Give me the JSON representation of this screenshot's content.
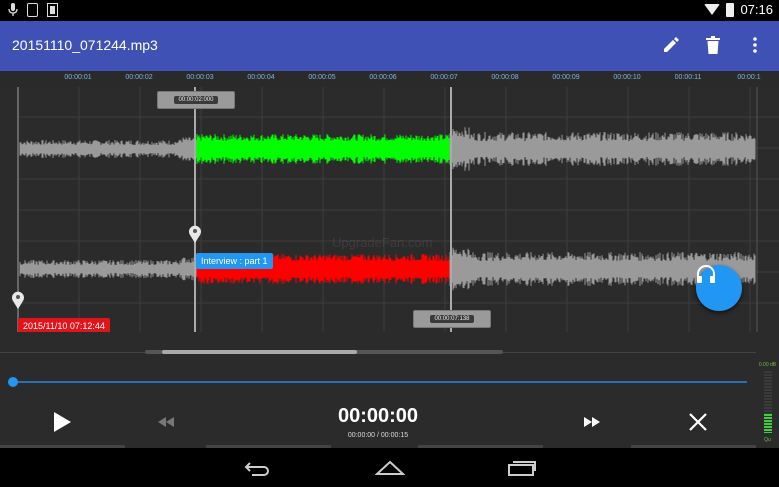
{
  "status_bar": {
    "time": "07:16",
    "left_icons": [
      "microphone-icon",
      "sim-icon",
      "storage-icon"
    ],
    "right_icons": [
      "wifi-icon",
      "battery-icon"
    ]
  },
  "app_bar": {
    "title": "20151110_071244.mp3",
    "color": "#3f51b5",
    "actions": [
      "edit-icon",
      "delete-icon",
      "more-vert-icon"
    ]
  },
  "timeline": {
    "ticks": [
      "00:00:01",
      "00:00:02",
      "00:00:03",
      "00:00:04",
      "00:00:05",
      "00:00:06",
      "00:00:07",
      "00:00:08",
      "00:00:09",
      "00:00:10",
      "00:00:11",
      "00:00:1"
    ]
  },
  "waveform": {
    "selection_start_marker": "00:00:02:000",
    "selection_end_marker": "00:00:07:138",
    "selection_color_top": "#00ff00",
    "selection_color_bottom": "#ff0000",
    "wave_color": "#9a9a9a",
    "watermark": "UpgradeFan.com",
    "markers": [
      {
        "label": "Interview : part 1",
        "color": "#2196f3"
      },
      {
        "label": "2015/11/10 07:12:44",
        "color": "#e0141a"
      }
    ]
  },
  "fab": {
    "icon": "headphones-icon",
    "color": "#2196f3"
  },
  "playback": {
    "position_fraction": 0,
    "current_time": "00:00:00",
    "sub_time": "00:00:00 / 00:00:15"
  },
  "transport": {
    "buttons": [
      "play-icon",
      "rewind-icon",
      "fast-forward-icon",
      "close-icon"
    ]
  },
  "level_meter": {
    "top_label": "0.00 dB",
    "bottom_label": "Qu",
    "level_fraction": 0.3
  },
  "nav_bar": {
    "buttons": [
      "back-icon",
      "home-icon",
      "recents-icon"
    ]
  }
}
